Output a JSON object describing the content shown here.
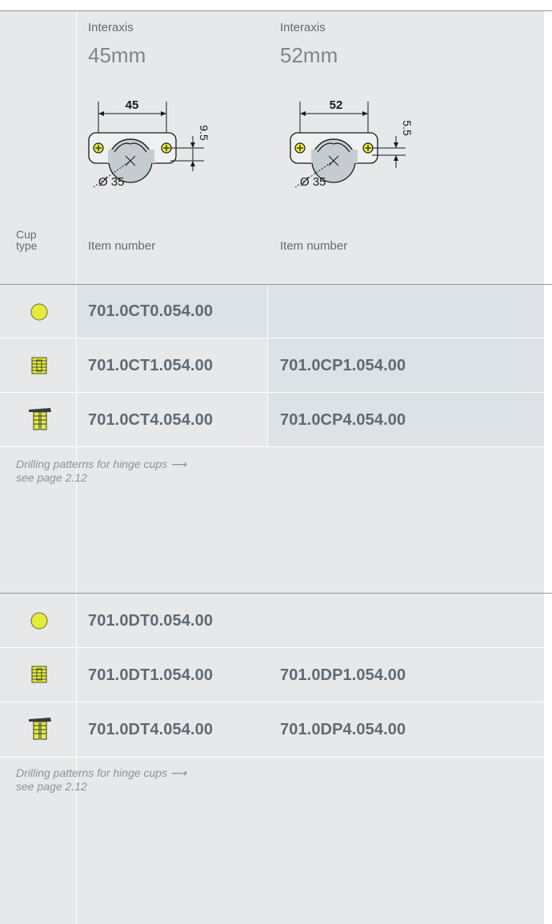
{
  "header": {
    "col1": {
      "sub": "Interaxis",
      "big": "45mm",
      "dim_width": "45",
      "dim_offset": "9.5",
      "diameter": "Ø 35"
    },
    "col2": {
      "sub": "Interaxis",
      "big": "52mm",
      "dim_width": "52",
      "dim_offset": "5.5",
      "diameter": "Ø 35"
    },
    "cup_type_line1": "Cup",
    "cup_type_line2": "type",
    "item_number_label_1": "Item number",
    "item_number_label_2": "Item number"
  },
  "table1": {
    "rows": [
      {
        "icon": "round-cup-icon",
        "col1": "701.0CT0.054.00",
        "col2": ""
      },
      {
        "icon": "dowel-cup-icon",
        "col1": "701.0CT1.054.00",
        "col2": "701.0CP1.054.00"
      },
      {
        "icon": "screw-flange-cup-icon",
        "col1": "701.0CT4.054.00",
        "col2": "701.0CP4.054.00"
      }
    ],
    "note_line1": "Drilling patterns for hinge cups ⟶",
    "note_line2": "see page 2.12"
  },
  "table2": {
    "rows": [
      {
        "icon": "round-cup-icon",
        "col1": "701.0DT0.054.00",
        "col2": ""
      },
      {
        "icon": "dowel-cup-icon",
        "col1": "701.0DT1.054.00",
        "col2": "701.0DP1.054.00"
      },
      {
        "icon": "screw-flange-cup-icon",
        "col1": "701.0DT4.054.00",
        "col2": "701.0DP4.054.00"
      }
    ],
    "note_line1": "Drilling patterns for hinge cups ⟶",
    "note_line2": "see page 2.12"
  },
  "colors": {
    "panel": "#e7e8e9",
    "shade": "#dce2e5",
    "cup_yellow": "#e4ec3a",
    "text": "#5f6b74"
  }
}
